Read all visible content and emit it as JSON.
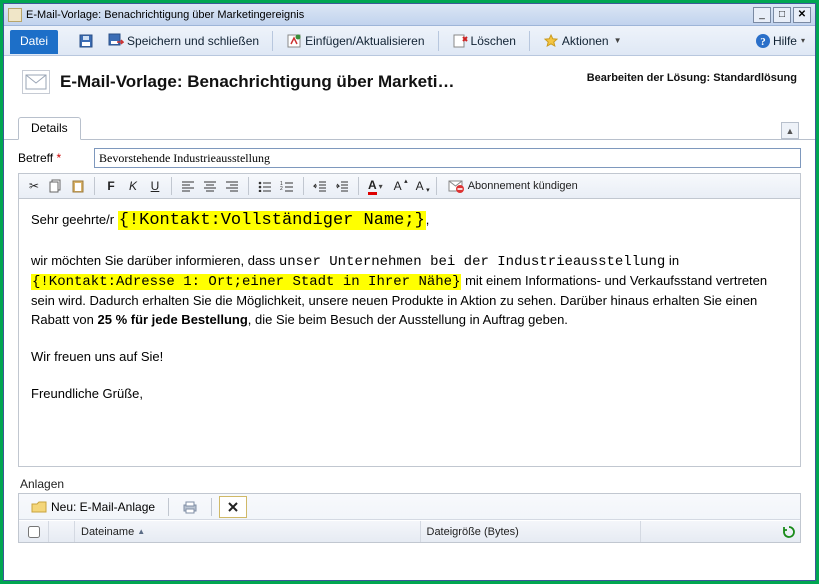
{
  "window": {
    "title": "E-Mail-Vorlage: Benachrichtigung über Marketingereignis"
  },
  "toolbar": {
    "file": "Datei",
    "save_close": "Speichern und schließen",
    "insert_update": "Einfügen/Aktualisieren",
    "delete": "Löschen",
    "actions": "Aktionen",
    "help": "Hilfe"
  },
  "header": {
    "title": "E-Mail-Vorlage: Benachrichtigung über Marketi…",
    "solution_label": "Bearbeiten der Lösung:",
    "solution_value": "Standardlösung"
  },
  "tabs": {
    "details": "Details"
  },
  "subject": {
    "label": "Betreff",
    "value": "Bevorstehende Industrieausstellung"
  },
  "rt": {
    "unsubscribe": "Abonnement kündigen"
  },
  "body": {
    "greeting_prefix": "Sehr geehrte/r ",
    "merge_name": "{!Kontakt:Vollständiger Name;}",
    "greeting_suffix": ",",
    "p2_a": "wir möchten Sie darüber informieren, dass ",
    "p2_b": "unser Unternehmen bei der Industrieausstellung",
    "p2_c": " in ",
    "merge_city": "{!Kontakt:Adresse 1: Ort;einer Stadt in Ihrer Nähe}",
    "p2_d": " mit einem Informations- und Verkaufsstand vertreten sein wird. Dadurch erhalten Sie die Möglichkeit, unsere neuen Produkte in Aktion zu sehen. Darüber hinaus erhalten Sie einen Rabatt von ",
    "p2_bold": "25 % für jede Bestellung",
    "p2_e": ", die Sie beim Besuch der Ausstellung in Auftrag geben.",
    "p3": "Wir freuen uns auf Sie!",
    "p4": "Freundliche Grüße,"
  },
  "attachments": {
    "section_label": "Anlagen",
    "new_label": "Neu: E-Mail-Anlage",
    "col_name": "Dateiname",
    "col_size": "Dateigröße (Bytes)"
  }
}
